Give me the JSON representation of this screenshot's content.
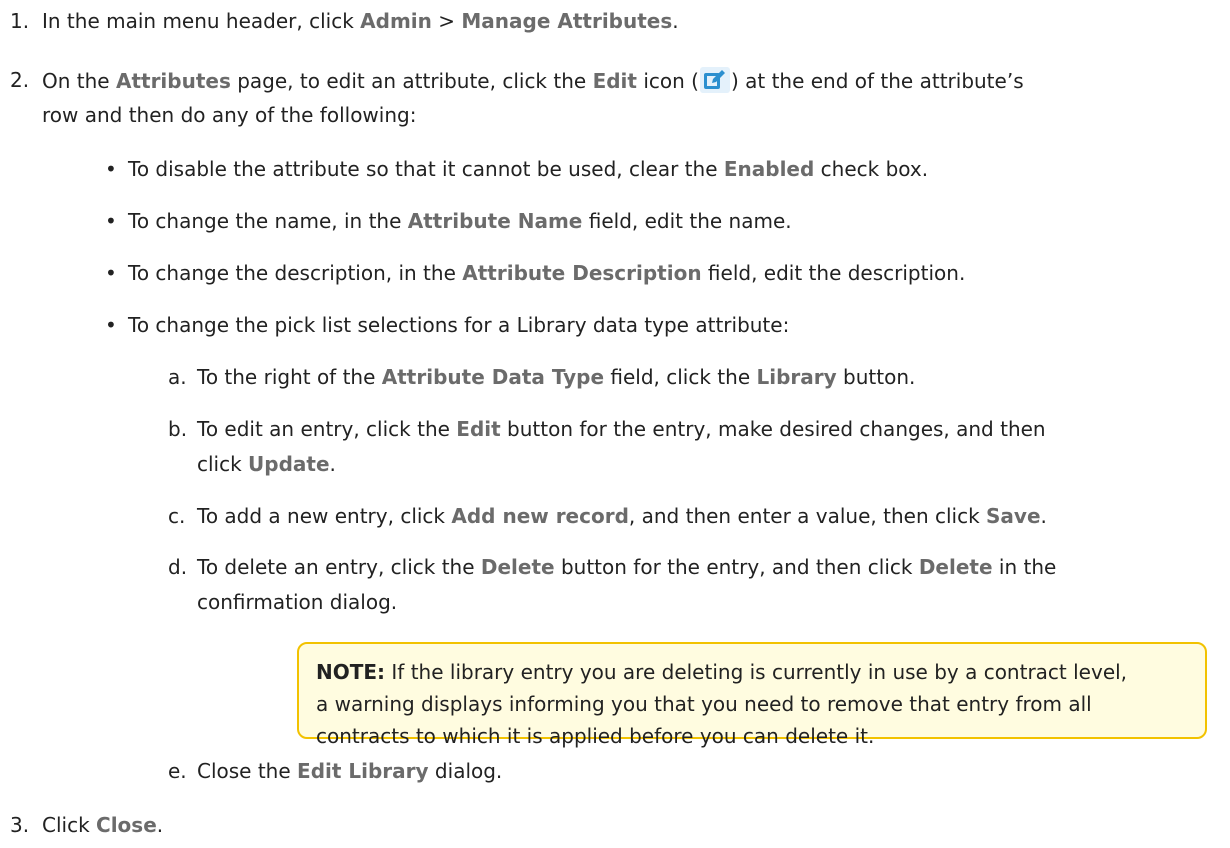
{
  "steps": {
    "s1": {
      "num": "1.",
      "a": "In the main menu header, click ",
      "admin": "Admin",
      "sep": " > ",
      "manage": "Manage Attributes",
      "end": "."
    },
    "s2": {
      "num": "2.",
      "a": "On the ",
      "attributes": "Attributes",
      "b": " page, to edit an attribute, click the ",
      "edit": "Edit",
      "c": " icon (",
      "d": ") at the end of the attribute’s",
      "cont": "row and then do any of the following:",
      "bullets": {
        "b1": {
          "a": "To disable the attribute so that it cannot be used, clear the ",
          "ui": "Enabled",
          "b": " check box."
        },
        "b2": {
          "a": "To change the name, in the ",
          "ui": "Attribute Name",
          "b": " field, edit the name."
        },
        "b3": {
          "a": "To change the description, in the ",
          "ui": "Attribute Description",
          "b": " field, edit the description."
        },
        "b4": {
          "a": "To change the pick list selections for a Library data type attribute:"
        }
      },
      "sub": {
        "a": {
          "letter": "a.",
          "a": "To the right of the ",
          "ui1": "Attribute Data Type",
          "b": " field, click the ",
          "ui2": "Library",
          "c": " button."
        },
        "b": {
          "letter": "b.",
          "a": "To edit an entry, click the ",
          "ui1": "Edit",
          "b": " button for the entry, make desired changes, and then",
          "cont_a": "click ",
          "ui2": "Update",
          "cont_b": "."
        },
        "c": {
          "letter": "c.",
          "a": "To add a new entry, click ",
          "ui1": "Add new record",
          "b": ", and then enter a value, then click ",
          "ui2": "Save",
          "c": "."
        },
        "d": {
          "letter": "d.",
          "a": "To delete an entry, click the ",
          "ui1": "Delete",
          "b": " button for the entry, and then click ",
          "ui2": "Delete",
          "c": " in the",
          "cont": "confirmation dialog."
        },
        "e": {
          "letter": "e.",
          "a": "Close the ",
          "ui1": "Edit Library",
          "b": " dialog."
        }
      }
    },
    "s3": {
      "num": "3.",
      "a": "Click ",
      "ui": "Close",
      "end": "."
    }
  },
  "note": {
    "label": "NOTE:",
    "line1": " If the library entry you are deleting is currently in use by a contract level,",
    "line2": "a warning displays informing you that you need to remove that entry from all",
    "line3": "contracts to which it is applied before you can delete it."
  },
  "icon": {
    "name": "edit-icon",
    "bg": "#e4f1fb",
    "color": "#2b8fcf"
  },
  "colors": {
    "ui_term": "#6b6b6b",
    "note_bg": "#fffce0",
    "note_border": "#f2c200"
  }
}
